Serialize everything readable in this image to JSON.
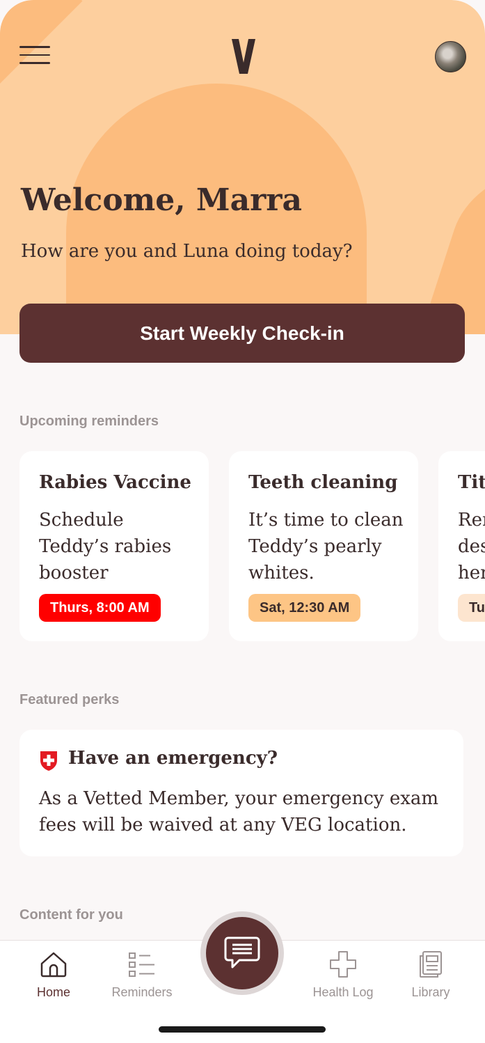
{
  "header": {
    "logo_letter": "V",
    "welcome": "Welcome, Marra",
    "subtitle": "How are you and Luna doing today?"
  },
  "cta": {
    "label": "Start Weekly Check-in"
  },
  "reminders": {
    "section_label": "Upcoming reminders",
    "items": [
      {
        "title": "Rabies Vaccine",
        "body": "Schedule Teddy’s rabies booster",
        "time": "Thurs, 8:00 AM",
        "badge_bg": "#ff0000",
        "badge_fg": "#ffffff"
      },
      {
        "title": "Teeth cleaning",
        "body": "It’s time to clean Teddy’s pearly whites.",
        "time": "Sat, 12:30 AM",
        "badge_bg": "#fdc585",
        "badge_fg": "#3a2b2b"
      },
      {
        "title": "Tit",
        "body": "Rer des her",
        "time": "Tu",
        "badge_bg": "#fde5cf",
        "badge_fg": "#3a2b2b"
      }
    ]
  },
  "perks": {
    "section_label": "Featured perks",
    "title": "Have an emergency?",
    "body": "As a Vetted Member, your emergency exam fees will be waived at any VEG location."
  },
  "content": {
    "section_label": "Content for you"
  },
  "tabs": [
    {
      "label": "Home",
      "icon": "home-icon"
    },
    {
      "label": "Reminders",
      "icon": "list-icon"
    },
    {
      "label": "Health Log",
      "icon": "cross-icon"
    },
    {
      "label": "Library",
      "icon": "library-icon"
    }
  ],
  "colors": {
    "accent": "#5c3131",
    "hero": "#fdcf9e",
    "hero_shape": "#fcbc7e",
    "background": "#faf7f7"
  }
}
